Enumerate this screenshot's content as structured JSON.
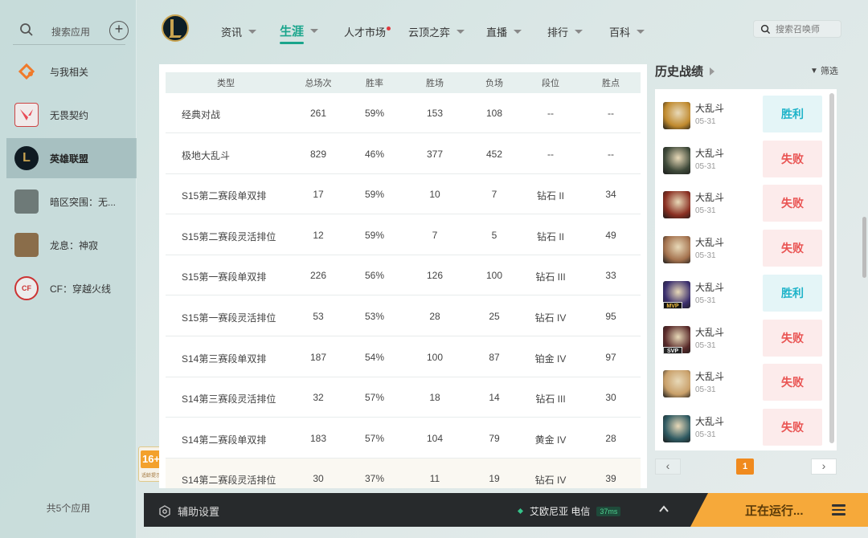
{
  "sidebar": {
    "search_label": "搜索应用",
    "add_symbol": "+",
    "items": [
      {
        "label": "与我相关",
        "icon": "related-icon"
      },
      {
        "label": "无畏契约",
        "icon": "valorant-icon"
      },
      {
        "label": "英雄联盟",
        "icon": "lol-icon",
        "active": true
      },
      {
        "label": "暗区突围：无...",
        "icon": "arena-breakout-icon"
      },
      {
        "label": "龙息：神寂",
        "icon": "dragon-breath-icon"
      },
      {
        "label": "CF：穿越火线",
        "icon": "crossfire-icon"
      }
    ],
    "count_label": "共5个应用"
  },
  "age_rating": {
    "value": "16+",
    "sub": "适龄提示"
  },
  "nav": {
    "items": [
      {
        "label": "资讯",
        "caret": true
      },
      {
        "label": "生涯",
        "caret": true,
        "active": true
      },
      {
        "label": "人才市场",
        "dot": true
      },
      {
        "label": "云顶之弈",
        "caret": true
      },
      {
        "label": "直播",
        "caret": true
      },
      {
        "label": "排行",
        "caret": true
      },
      {
        "label": "百科",
        "caret": true
      }
    ],
    "search_placeholder": "搜索召唤师"
  },
  "stats": {
    "headers": {
      "type": "类型",
      "total": "总场次",
      "rate": "胜率",
      "win": "胜场",
      "loss": "负场",
      "tier": "段位",
      "lp": "胜点"
    },
    "rows": [
      {
        "type": "经典对战",
        "total": "261",
        "rate": "59%",
        "win": "153",
        "loss": "108",
        "tier": "--",
        "lp": "--"
      },
      {
        "type": "极地大乱斗",
        "total": "829",
        "rate": "46%",
        "win": "377",
        "loss": "452",
        "tier": "--",
        "lp": "--"
      },
      {
        "type": "S15第二赛段单双排",
        "total": "17",
        "rate": "59%",
        "win": "10",
        "loss": "7",
        "tier": "钻石 II",
        "lp": "34"
      },
      {
        "type": "S15第二赛段灵活排位",
        "total": "12",
        "rate": "59%",
        "win": "7",
        "loss": "5",
        "tier": "钻石 II",
        "lp": "49"
      },
      {
        "type": "S15第一赛段单双排",
        "total": "226",
        "rate": "56%",
        "win": "126",
        "loss": "100",
        "tier": "钻石 III",
        "lp": "33"
      },
      {
        "type": "S15第一赛段灵活排位",
        "total": "53",
        "rate": "53%",
        "win": "28",
        "loss": "25",
        "tier": "钻石 IV",
        "lp": "95"
      },
      {
        "type": "S14第三赛段单双排",
        "total": "187",
        "rate": "54%",
        "win": "100",
        "loss": "87",
        "tier": "铂金 IV",
        "lp": "97"
      },
      {
        "type": "S14第三赛段灵活排位",
        "total": "32",
        "rate": "57%",
        "win": "18",
        "loss": "14",
        "tier": "钻石 III",
        "lp": "30"
      },
      {
        "type": "S14第二赛段单双排",
        "total": "183",
        "rate": "57%",
        "win": "104",
        "loss": "79",
        "tier": "黄金 IV",
        "lp": "28"
      },
      {
        "type": "S14第二赛段灵活排位",
        "total": "30",
        "rate": "37%",
        "win": "11",
        "loss": "19",
        "tier": "钻石 IV",
        "lp": "39"
      }
    ]
  },
  "history": {
    "title": "历史战绩",
    "filter_label": "筛选",
    "matches": [
      {
        "mode": "大乱斗",
        "date": "05-31",
        "result": "胜利",
        "win": true,
        "badge": "",
        "color": "#c08a2e"
      },
      {
        "mode": "大乱斗",
        "date": "05-31",
        "result": "失败",
        "win": false,
        "badge": "",
        "color": "#3f4a3a"
      },
      {
        "mode": "大乱斗",
        "date": "05-31",
        "result": "失败",
        "win": false,
        "badge": "",
        "color": "#8a2f22"
      },
      {
        "mode": "大乱斗",
        "date": "05-31",
        "result": "失败",
        "win": false,
        "badge": "",
        "color": "#a4724e"
      },
      {
        "mode": "大乱斗",
        "date": "05-31",
        "result": "胜利",
        "win": true,
        "badge": "MVP",
        "color": "#3b2f6e"
      },
      {
        "mode": "大乱斗",
        "date": "05-31",
        "result": "失败",
        "win": false,
        "badge": "SVP",
        "color": "#5a2b2b"
      },
      {
        "mode": "大乱斗",
        "date": "05-31",
        "result": "失败",
        "win": false,
        "badge": "",
        "color": "#c9a06a"
      },
      {
        "mode": "大乱斗",
        "date": "05-31",
        "result": "失败",
        "win": false,
        "badge": "",
        "color": "#2f5a62"
      }
    ],
    "pager": {
      "prev": "‹",
      "current": "1",
      "next": "›"
    }
  },
  "bottom": {
    "assist_label": "辅助设置",
    "server_label": "艾欧尼亚 电信",
    "ping": "37ms",
    "running_label": "正在运行..."
  }
}
